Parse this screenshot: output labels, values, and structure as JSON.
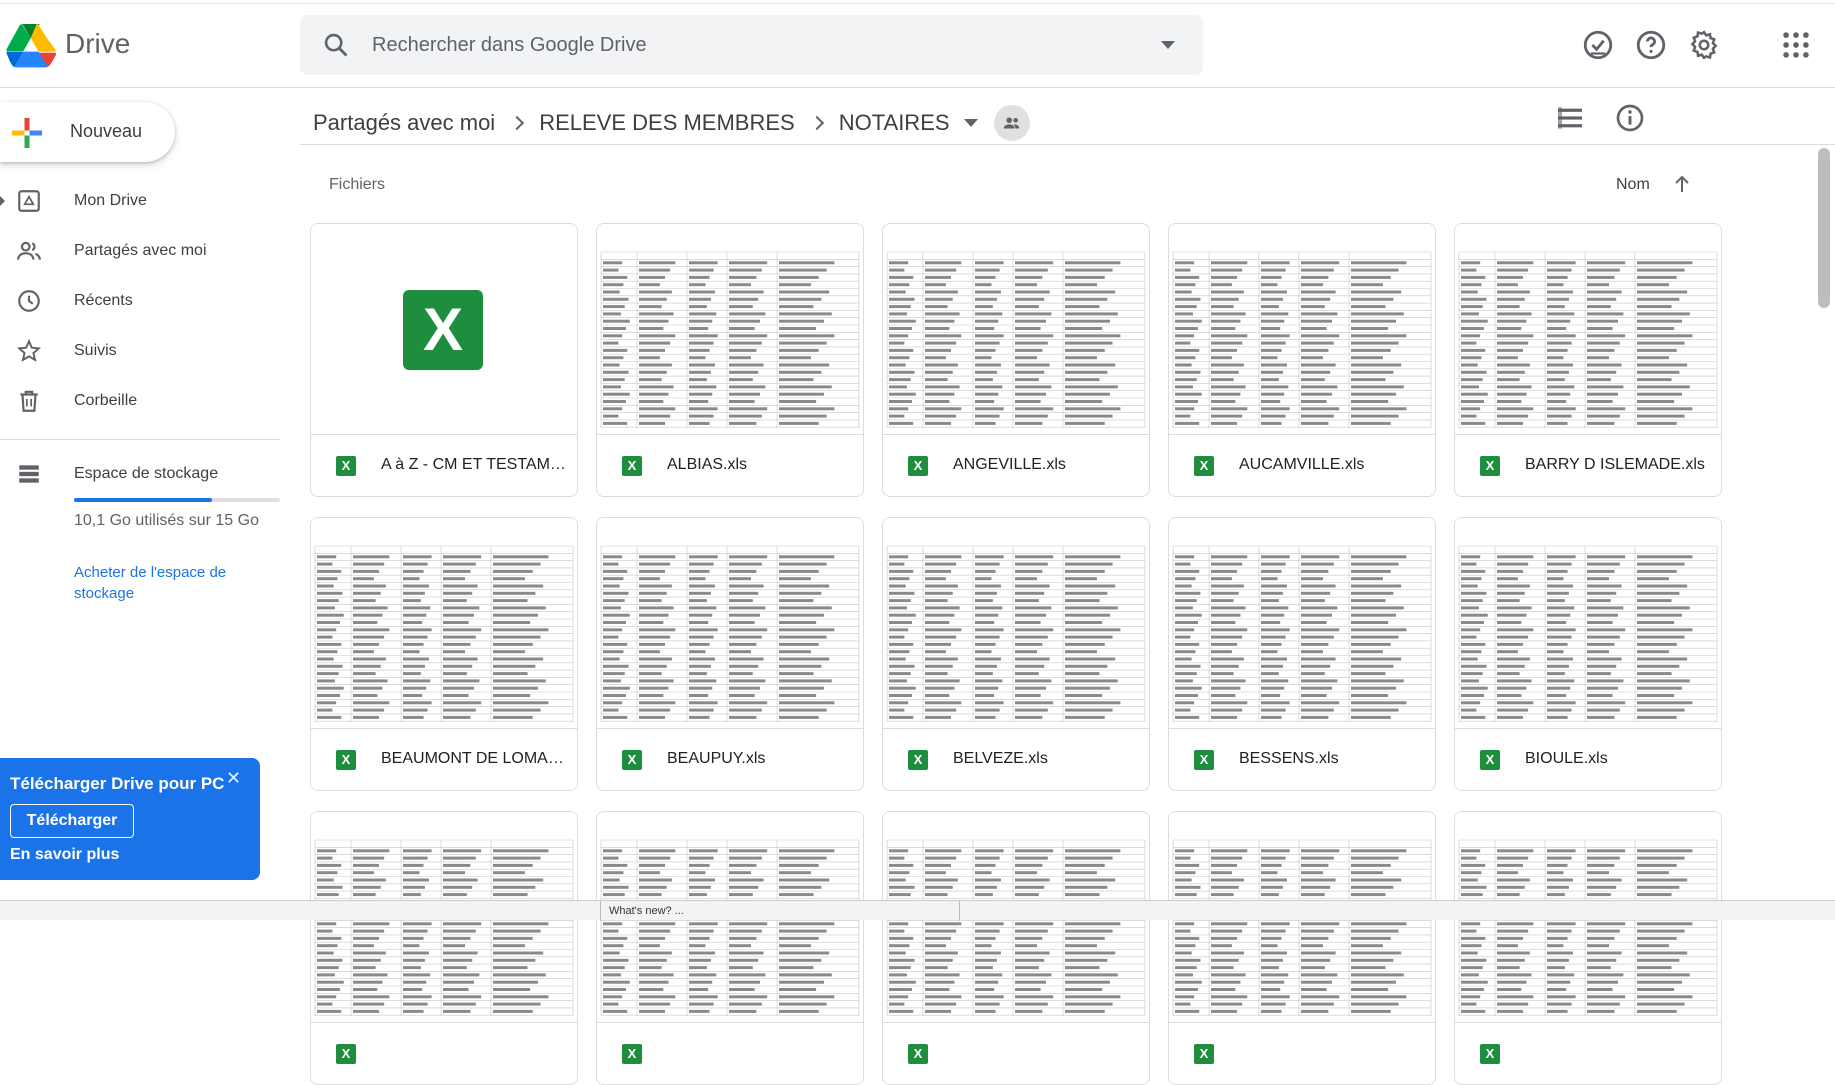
{
  "app": {
    "product_name": "Drive"
  },
  "search": {
    "placeholder": "Rechercher dans Google Drive"
  },
  "sidebar": {
    "new_label": "Nouveau",
    "items": [
      {
        "label": "Mon Drive",
        "icon": "my-drive-icon"
      },
      {
        "label": "Partagés avec moi",
        "icon": "shared-people-icon"
      },
      {
        "label": "Récents",
        "icon": "clock-icon"
      },
      {
        "label": "Suivis",
        "icon": "star-icon"
      },
      {
        "label": "Corbeille",
        "icon": "trash-icon"
      }
    ],
    "storage": {
      "label": "Espace de stockage",
      "used_text": "10,1 Go utilisés sur 15 Go",
      "used_fraction": 0.67,
      "buy_link": "Acheter de l'espace de stockage"
    }
  },
  "promo": {
    "title": "Télécharger Drive pour PC",
    "download_label": "Télécharger",
    "learn_more": "En savoir plus",
    "close": "✕"
  },
  "breadcrumb": [
    "Partagés avec moi",
    "RELEVE DES MEMBRES",
    "NOTAIRES"
  ],
  "section": {
    "files_label": "Fichiers",
    "sort_label": "Nom"
  },
  "files": [
    {
      "name": "A à Z - CM ET TESTAMENTS.xls",
      "thumb": "excel"
    },
    {
      "name": "ALBIAS.xls",
      "thumb": "sheet"
    },
    {
      "name": "ANGEVILLE.xls",
      "thumb": "sheet"
    },
    {
      "name": "AUCAMVILLE.xls",
      "thumb": "sheet"
    },
    {
      "name": "BARRY D ISLEMADE.xls",
      "thumb": "sheet"
    },
    {
      "name": "BEAUMONT DE LOMAGNE.xls",
      "thumb": "sheet"
    },
    {
      "name": "BEAUPUY.xls",
      "thumb": "sheet"
    },
    {
      "name": "BELVEZE.xls",
      "thumb": "sheet"
    },
    {
      "name": "BESSENS.xls",
      "thumb": "sheet"
    },
    {
      "name": "BIOULE.xls",
      "thumb": "sheet"
    },
    {
      "name": "",
      "thumb": "sheet"
    },
    {
      "name": "",
      "thumb": "sheet"
    },
    {
      "name": "",
      "thumb": "sheet"
    },
    {
      "name": "",
      "thumb": "sheet"
    },
    {
      "name": "",
      "thumb": "sheet"
    }
  ],
  "file_type_badge": "X",
  "taskbar": {
    "item": "What's new? ..."
  },
  "colors": {
    "accent": "#1a73e8",
    "excel_green": "#1e8e3e"
  }
}
